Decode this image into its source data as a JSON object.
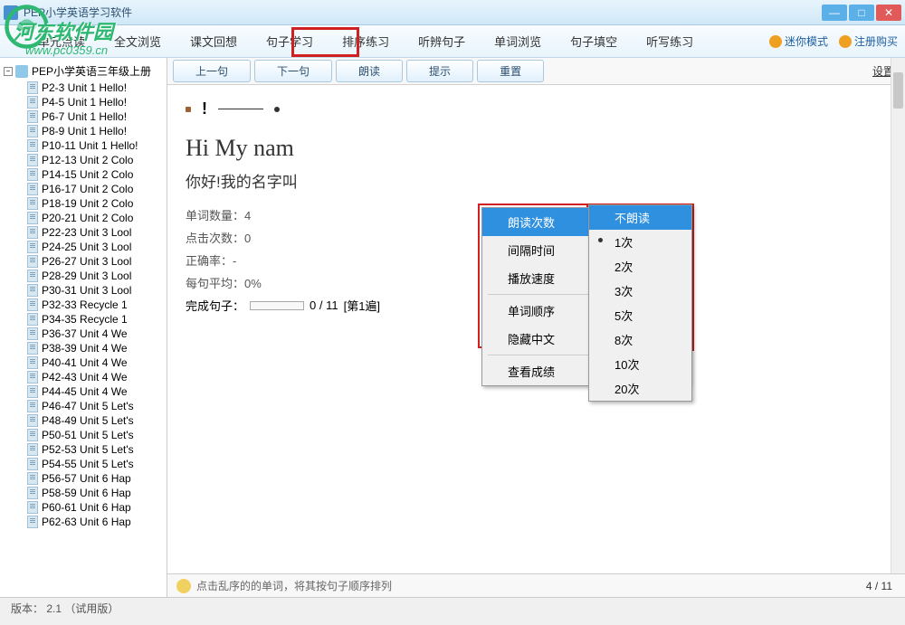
{
  "window": {
    "title": "PEP小学英语学习软件"
  },
  "watermark": {
    "text": "河东软件园",
    "url": "www.pc0359.cn"
  },
  "menubar": {
    "items": [
      "单元点读",
      "全文浏览",
      "课文回想",
      "句子学习",
      "排序练习",
      "听辨句子",
      "单词浏览",
      "句子填空",
      "听写练习"
    ],
    "right": {
      "mini": "迷你模式",
      "register": "注册购买"
    }
  },
  "sidebar": {
    "root": "PEP小学英语三年级上册",
    "items": [
      "P2-3 Unit 1 Hello!",
      "P4-5 Unit 1 Hello!",
      "P6-7 Unit 1 Hello!",
      "P8-9 Unit 1 Hello!",
      "P10-11 Unit 1 Hello!",
      "P12-13 Unit 2 Colo",
      "P14-15 Unit 2 Colo",
      "P16-17 Unit 2 Colo",
      "P18-19 Unit 2 Colo",
      "P20-21 Unit 2 Colo",
      "P22-23 Unit 3 Lool",
      "P24-25 Unit 3 Lool",
      "P26-27 Unit 3 Lool",
      "P28-29 Unit 3 Lool",
      "P30-31 Unit 3 Lool",
      "P32-33 Recycle 1",
      "P34-35 Recycle 1",
      "P36-37 Unit 4 We",
      "P38-39 Unit 4 We",
      "P40-41 Unit 4 We",
      "P42-43 Unit 4 We",
      "P44-45 Unit 4 We",
      "P46-47 Unit 5 Let's",
      "P48-49 Unit 5 Let's",
      "P50-51 Unit 5 Let's",
      "P52-53 Unit 5 Let's",
      "P54-55 Unit 5 Let's",
      "P56-57 Unit 6 Hap",
      "P58-59 Unit 6 Hap",
      "P60-61 Unit 6 Hap",
      "P62-63 Unit 6 Hap"
    ]
  },
  "toolbar": {
    "prev": "上一句",
    "next": "下一句",
    "read": "朗读",
    "hint": "提示",
    "reset": "重置",
    "settings": "设置"
  },
  "exercise": {
    "word_prefix": "!",
    "english": "Hi  My  nam",
    "chinese": "你好!我的名字叫",
    "stats": {
      "word_count_label": "单词数量：",
      "word_count": "4",
      "click_count_label": "点击次数：",
      "click_count": "0",
      "accuracy_label": "正确率：",
      "accuracy": "-",
      "avg_label": "每句平均：",
      "avg": "0%",
      "progress_label": "完成句子：",
      "progress": "0 / 11",
      "round": "[第1遍]"
    }
  },
  "context_menu": {
    "items": [
      {
        "label": "朗读次数",
        "arrow": true,
        "highlighted": true
      },
      {
        "label": "间隔时间",
        "arrow": true
      },
      {
        "label": "播放速度",
        "arrow": true
      },
      {
        "sep": true
      },
      {
        "label": "单词顺序",
        "arrow": true
      },
      {
        "label": "隐藏中文"
      },
      {
        "sep": true
      },
      {
        "label": "查看成绩"
      }
    ]
  },
  "submenu": {
    "items": [
      {
        "label": "不朗读",
        "highlighted": true
      },
      {
        "label": "1次",
        "bullet": true
      },
      {
        "label": "2次"
      },
      {
        "label": "3次"
      },
      {
        "label": "5次"
      },
      {
        "label": "8次"
      },
      {
        "label": "10次"
      },
      {
        "label": "20次"
      }
    ]
  },
  "hint": {
    "text": "点击乱序的的单词，将其按句子顺序排列",
    "page": "4 / 11"
  },
  "statusbar": {
    "text": "版本： 2.1   （试用版）"
  }
}
